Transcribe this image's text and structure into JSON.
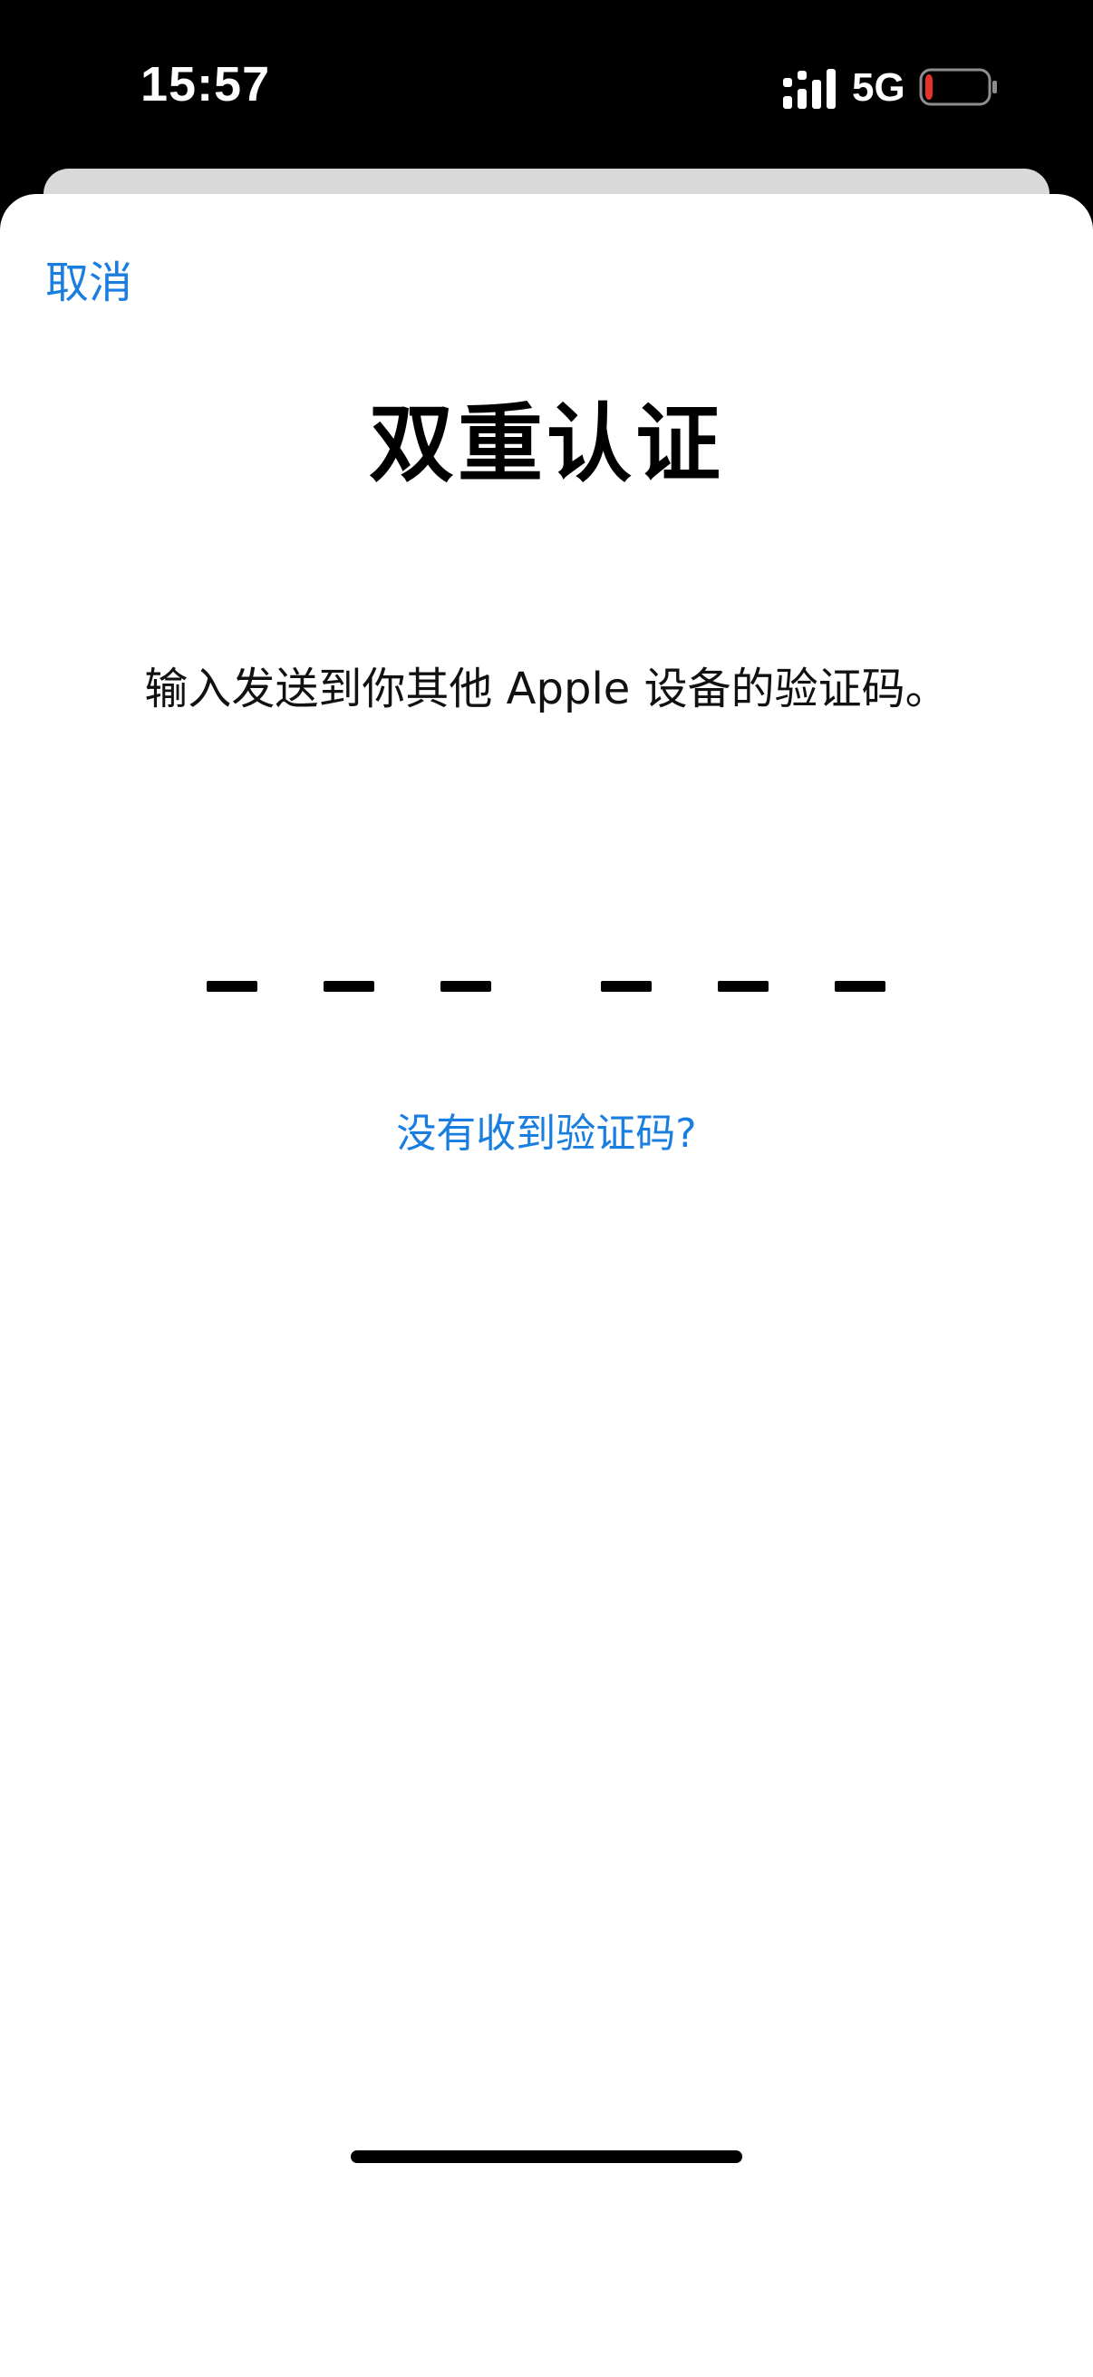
{
  "status_bar": {
    "time": "15:57",
    "network": "5G",
    "signal_icon": "cellular-signal-icon",
    "battery_icon": "battery-low-icon",
    "battery_level": 0.12,
    "battery_color": "#e5322d"
  },
  "sheet": {
    "cancel_label": "取消",
    "title": "双重认证",
    "instruction": "输入发送到你其他 Apple 设备的验证码。",
    "code_digits": 6,
    "resend_label": "没有收到验证码?"
  },
  "colors": {
    "accent": "#1a7ee0",
    "background": "#ffffff"
  }
}
